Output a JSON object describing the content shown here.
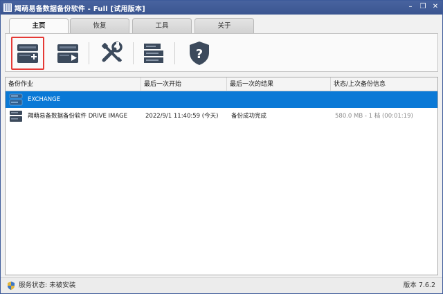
{
  "window": {
    "title": "羯萌易备数据备份软件 - Full [试用版本]",
    "minimize": "–",
    "restore": "❐",
    "close": "✕"
  },
  "tabs": [
    {
      "label": "主页",
      "active": true
    },
    {
      "label": "恢复",
      "active": false
    },
    {
      "label": "工具",
      "active": false
    },
    {
      "label": "关于",
      "active": false
    }
  ],
  "toolbar": [
    {
      "icon": "new-backup-icon",
      "highlighted": true
    },
    {
      "icon": "run-backup-icon",
      "highlighted": false
    },
    {
      "icon": "tools-icon",
      "highlighted": false
    },
    {
      "icon": "logs-icon",
      "highlighted": false
    },
    {
      "icon": "help-shield-icon",
      "highlighted": false
    }
  ],
  "list": {
    "columns": [
      "备份作业",
      "最后一次开始",
      "最后一次的结果",
      "状态/上次备份信息"
    ],
    "rows": [
      {
        "name": "EXCHANGE",
        "last_start": "",
        "last_result": "",
        "status": "",
        "selected": true
      },
      {
        "name": "羯萌易备数据备份软件 DRIVE IMAGE",
        "last_start": "2022/9/1 11:40:59 (今天)",
        "last_result": "备份成功完成",
        "status": "580.0 MB - 1 档 (00:01:19)",
        "selected": false
      }
    ]
  },
  "status": {
    "service_text": "服务状态: 未被安装",
    "version_text": "版本 7.6.2"
  },
  "colors": {
    "titlebar": "#3f5a96",
    "selection": "#0a79d6",
    "highlight_border": "#e53935",
    "icon_dark": "#3c4a5c"
  }
}
